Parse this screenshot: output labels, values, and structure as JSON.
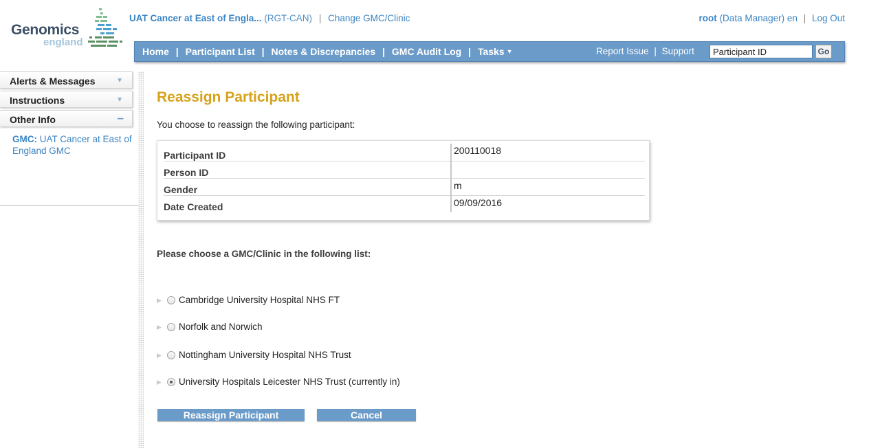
{
  "branding": {
    "logo_word": "Genomics",
    "logo_sub": "england"
  },
  "header": {
    "study_name": "UAT Cancer at East of Engla...",
    "study_code": "(RGT-CAN)",
    "separator": "|",
    "change_link": "Change GMC/Clinic",
    "user_name": "root",
    "user_role": "(Data Manager)",
    "language": "en",
    "logout": "Log Out"
  },
  "navbar": {
    "items": [
      "Home",
      "Participant List",
      "Notes & Discrepancies",
      "GMC Audit Log",
      "Tasks"
    ],
    "separator": "|",
    "report_issue": "Report Issue",
    "support": "Support",
    "search_value": "Participant ID",
    "go_label": "Go"
  },
  "sidebar": {
    "tabs": [
      {
        "label": "Alerts & Messages",
        "state": "collapsed"
      },
      {
        "label": "Instructions",
        "state": "collapsed"
      },
      {
        "label": "Other Info",
        "state": "expanded"
      }
    ],
    "gmc_label": "GMC:",
    "gmc_value": "UAT Cancer at East of England GMC"
  },
  "main": {
    "title": "Reassign Participant",
    "intro": "You choose to reassign the following participant:",
    "participant": [
      {
        "label": "Participant ID",
        "value": "200110018"
      },
      {
        "label": "Person ID",
        "value": ""
      },
      {
        "label": "Gender",
        "value": "m"
      },
      {
        "label": "Date Created",
        "value": "09/09/2016"
      }
    ],
    "choose_prompt": "Please choose a GMC/Clinic in the following list:",
    "options": [
      {
        "label": "Cambridge University Hospital NHS FT",
        "selected": false
      },
      {
        "label": "Norfolk and Norwich",
        "selected": false
      },
      {
        "label": "Nottingham University Hospital NHS Trust",
        "selected": false
      },
      {
        "label": "University Hospitals Leicester NHS Trust (currently in)",
        "selected": true
      }
    ],
    "reassign_button": "Reassign Participant",
    "cancel_button": "Cancel"
  },
  "colors": {
    "accent": "#6b9bc9",
    "title": "#d6a21a",
    "link": "#3a84c3"
  }
}
